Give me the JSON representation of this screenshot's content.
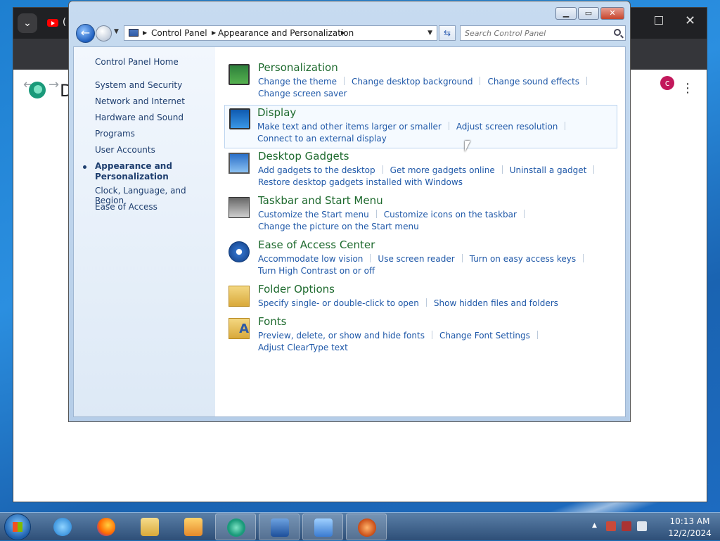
{
  "browser": {
    "tab_title": "(",
    "page_heading_letter": "D",
    "profile_initial": "c"
  },
  "window": {
    "address": {
      "segments": [
        "Control Panel",
        "Appearance and Personalization"
      ]
    },
    "search": {
      "placeholder": "Search Control Panel"
    }
  },
  "sidebar": {
    "home": "Control Panel Home",
    "items": [
      {
        "label": "System and Security"
      },
      {
        "label": "Network and Internet"
      },
      {
        "label": "Hardware and Sound"
      },
      {
        "label": "Programs"
      },
      {
        "label": "User Accounts"
      },
      {
        "label": "Appearance and Personalization",
        "current": true
      },
      {
        "label": "Clock, Language, and Region"
      },
      {
        "label": "Ease of Access"
      }
    ]
  },
  "categories": [
    {
      "title": "Personalization",
      "icon": "personalization-icon",
      "links": [
        "Change the theme",
        "Change desktop background",
        "Change sound effects",
        "Change screen saver"
      ]
    },
    {
      "title": "Display",
      "icon": "display-icon",
      "links": [
        "Make text and other items larger or smaller",
        "Adjust screen resolution",
        "Connect to an external display"
      ]
    },
    {
      "title": "Desktop Gadgets",
      "icon": "gadgets-icon",
      "links": [
        "Add gadgets to the desktop",
        "Get more gadgets online",
        "Uninstall a gadget",
        "Restore desktop gadgets installed with Windows"
      ]
    },
    {
      "title": "Taskbar and Start Menu",
      "icon": "taskbar-icon",
      "links": [
        "Customize the Start menu",
        "Customize icons on the taskbar",
        "Change the picture on the Start menu"
      ]
    },
    {
      "title": "Ease of Access Center",
      "icon": "ease-of-access-icon",
      "links": [
        "Accommodate low vision",
        "Use screen reader",
        "Turn on easy access keys",
        "Turn High Contrast on or off"
      ]
    },
    {
      "title": "Folder Options",
      "icon": "folder-options-icon",
      "links": [
        "Specify single- or double-click to open",
        "Show hidden files and folders"
      ]
    },
    {
      "title": "Fonts",
      "icon": "fonts-icon",
      "links": [
        "Preview, delete, or show and hide fonts",
        "Change Font Settings",
        "Adjust ClearType text"
      ]
    }
  ],
  "taskbar": {
    "clock": {
      "time": "10:13 AM",
      "date": "12/2/2024"
    }
  },
  "colors": {
    "category_title": "#1e6a2e",
    "link": "#1f58a8",
    "sidebar_text": "#1e3e6f"
  }
}
